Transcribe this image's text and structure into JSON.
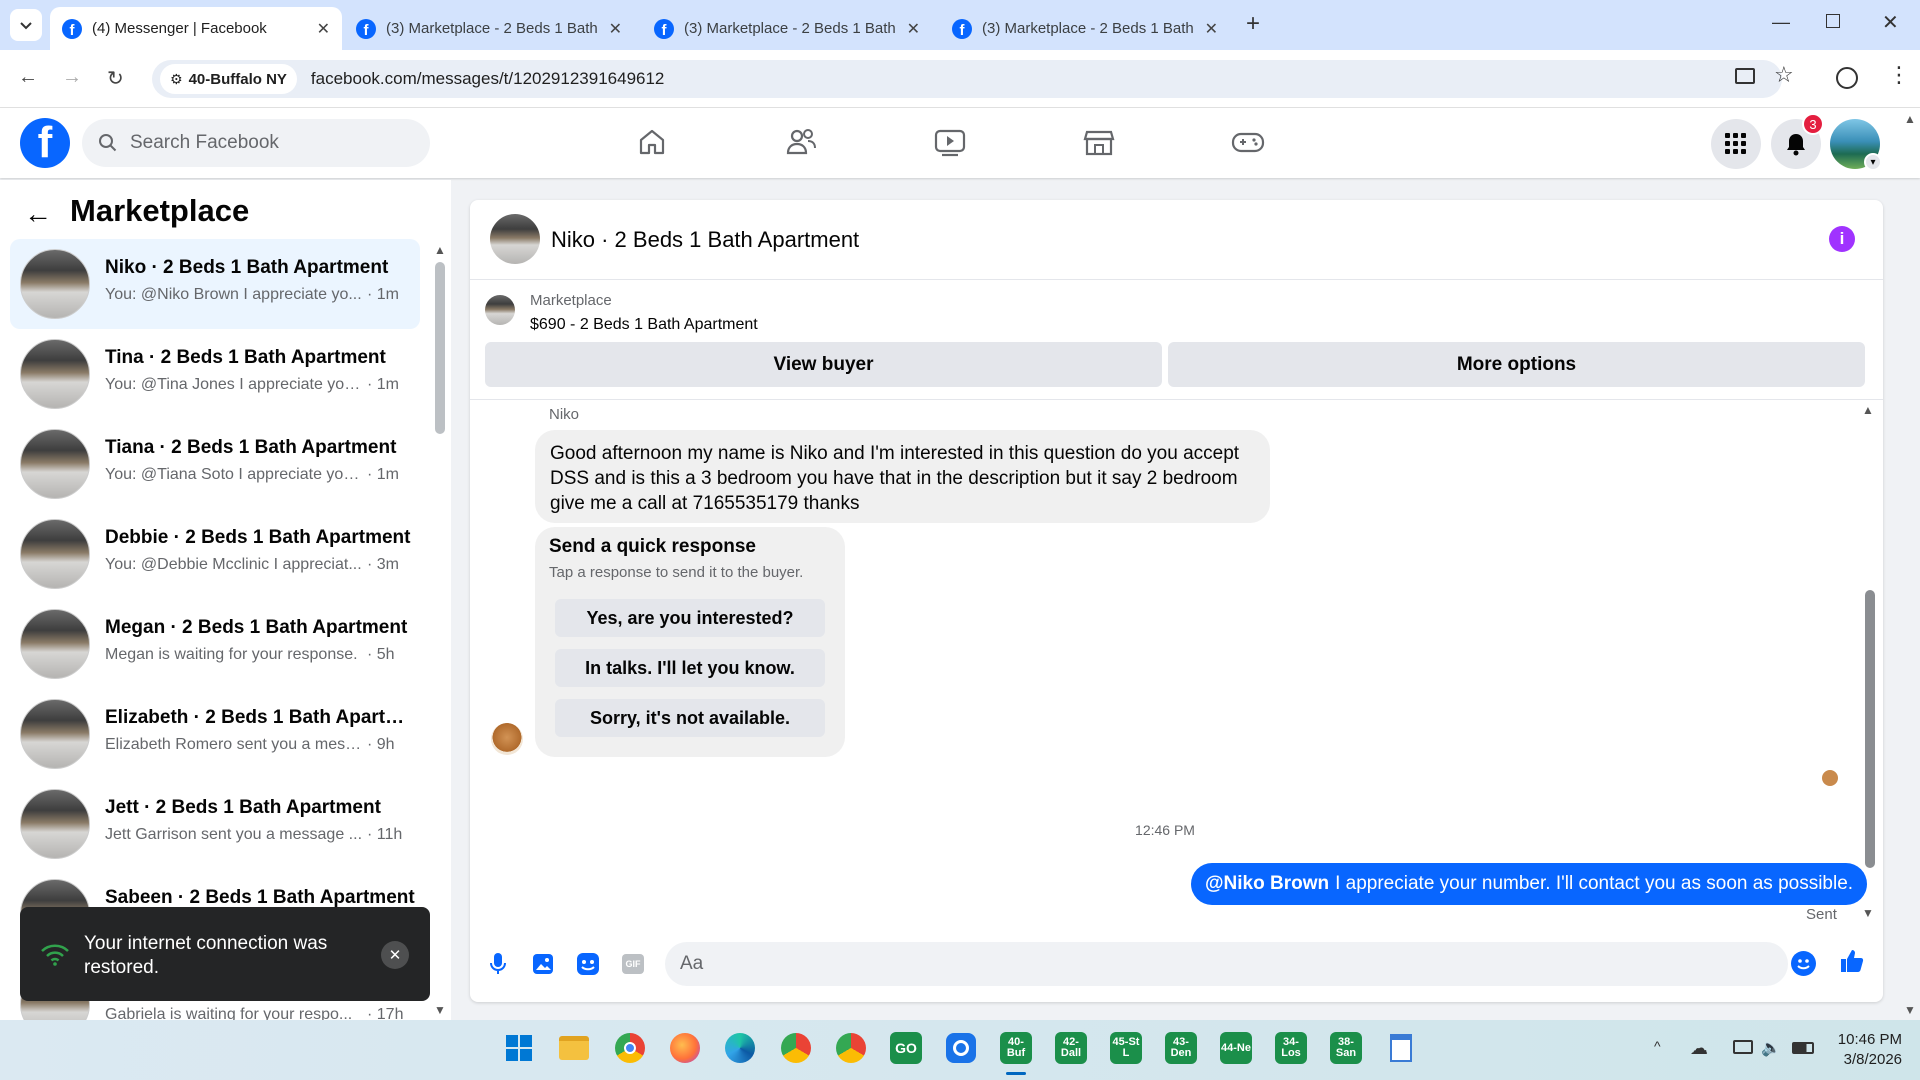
{
  "browser": {
    "tabs": [
      {
        "title": "(4) Messenger | Facebook",
        "active": true
      },
      {
        "title": "(3) Marketplace - 2 Beds 1 Bath",
        "active": false
      },
      {
        "title": "(3) Marketplace - 2 Beds 1 Bath",
        "active": false
      },
      {
        "title": "(3) Marketplace - 2 Beds 1 Bath",
        "active": false
      }
    ],
    "site_chip": "40-Buffalo NY",
    "url": "facebook.com/messages/t/1202912391649612"
  },
  "fb": {
    "search_placeholder": "Search Facebook",
    "notification_count": "3"
  },
  "sidebar": {
    "title": "Marketplace",
    "conversations": [
      {
        "name": "Niko · 2 Beds 1 Bath Apartment",
        "preview": "You: @Niko Brown I appreciate yo...",
        "time": "· 1m",
        "selected": true
      },
      {
        "name": "Tina · 2 Beds 1 Bath Apartment",
        "preview": "You: @Tina Jones I appreciate your...",
        "time": "· 1m"
      },
      {
        "name": "Tiana · 2 Beds 1 Bath Apartment",
        "preview": "You: @Tiana Soto I appreciate you...",
        "time": "· 1m"
      },
      {
        "name": "Debbie · 2 Beds 1 Bath Apartment",
        "preview": "You: @Debbie Mcclinic I appreciat...",
        "time": "· 3m"
      },
      {
        "name": "Megan · 2 Beds 1 Bath Apartment",
        "preview": "Megan is waiting for your response.",
        "time": "· 5h"
      },
      {
        "name": "Elizabeth · 2 Beds 1 Bath Apartm...",
        "preview": "Elizabeth Romero sent you a messa...",
        "time": "· 9h"
      },
      {
        "name": "Jett · 2 Beds 1 Bath Apartment",
        "preview": "Jett Garrison sent you a message ...",
        "time": "· 11h"
      },
      {
        "name": "Sabeen · 2 Beds 1 Bath Apartment",
        "preview": "",
        "time": ""
      },
      {
        "name": "",
        "preview": "Gabriela is waiting for your respo...",
        "time": "· 17h"
      }
    ]
  },
  "toast": {
    "message": "Your internet connection was restored."
  },
  "chat": {
    "title": "Niko · 2 Beds 1 Bath Apartment",
    "listing_source": "Marketplace",
    "listing_title": "$690 - 2 Beds 1 Bath Apartment",
    "view_buyer": "View buyer",
    "more_options": "More options",
    "sender": "Niko",
    "incoming_message": "Good afternoon my name is Niko and I'm interested in this question do you accept DSS and is this a 3 bedroom you have that in the description but it say 2 bedroom give me a call at 7165535179 thanks",
    "quick_response": {
      "title": "Send a quick response",
      "subtitle": "Tap a response to send it to the buyer.",
      "options": [
        "Yes, are you interested?",
        "In talks. I'll let you know.",
        "Sorry, it's not available."
      ]
    },
    "timestamp": "12:46 PM",
    "outgoing_mention": "@Niko Brown",
    "outgoing_text": "I appreciate your number. I'll contact you as soon as possible.",
    "status": "Sent",
    "composer_placeholder": "Aa"
  },
  "taskbar": {
    "apps": [
      "40-Buf",
      "42-Dall",
      "45-St L",
      "43-Den",
      "44-Ne",
      "34-Los",
      "38-San"
    ],
    "time": "10:46 PM",
    "date": "3/8/2026"
  }
}
